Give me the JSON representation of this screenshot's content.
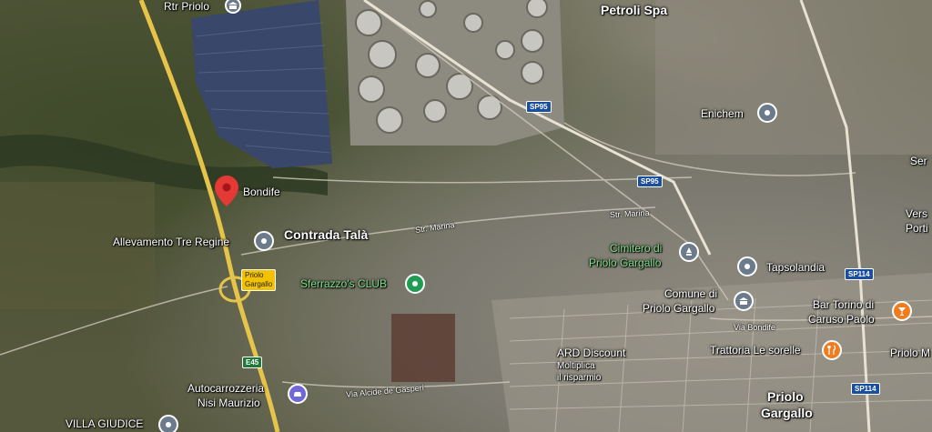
{
  "map": {
    "places": {
      "rtr_priolo": "Rtr Priolo",
      "petroli_spa": "Petroli Spa",
      "enichem": "Enichem",
      "bondife": "Bondife",
      "contrada_tala": "Contrada Talà",
      "allevamento": "Allevamento Tre Regine",
      "cimitero_line1": "Cimitero di",
      "cimitero_line2": "Priolo Gargallo",
      "tapsolandia": "Tapsolandia",
      "comune_line1": "Comune di",
      "comune_line2": "Priolo Gargallo",
      "sferrazzo": "Sferrazzo's CLUB",
      "bar_line1": "Bar Torino di",
      "bar_line2": "Caruso Paolo",
      "trattoria": "Trattoria Le sorelle",
      "ard_line1": "ARD Discount",
      "ard_line2": "Moltiplica",
      "ard_line3": "il risparmio",
      "autocarrozzeria_line1": "Autocarrozzeria",
      "autocarrozzeria_line2": "Nisi Maurizio",
      "priolo_line1": "Priolo",
      "priolo_line2": "Gargallo",
      "villa_giudice": "VILLA GIUDICE",
      "priolo_m": "Priolo M",
      "ser": "Ser",
      "vers_line1": "Vers",
      "vers_line2": "Porti"
    },
    "roads": {
      "str_marina_1": "Str. Marina",
      "str_marina_2": "Str. Marina",
      "via_bondife": "Via Bondife",
      "via_alcide": "Via Alcide de Gasperi"
    },
    "shields": {
      "sp95_a": "SP95",
      "sp95_b": "SP95",
      "sp114_a": "SP114",
      "sp114_b": "SP114",
      "e45": "E45"
    },
    "exit_sign": {
      "line1": "Priolo",
      "line2": "Gargallo"
    },
    "colors": {
      "highway": "#e6c44a",
      "pin_gray": "#6b7b8c",
      "pin_green": "#1f9d55",
      "pin_orange": "#ef7d1f",
      "pin_purple": "#7068d8",
      "red_pin": "#e53935",
      "shield_blue": "#1a4fa0"
    }
  }
}
